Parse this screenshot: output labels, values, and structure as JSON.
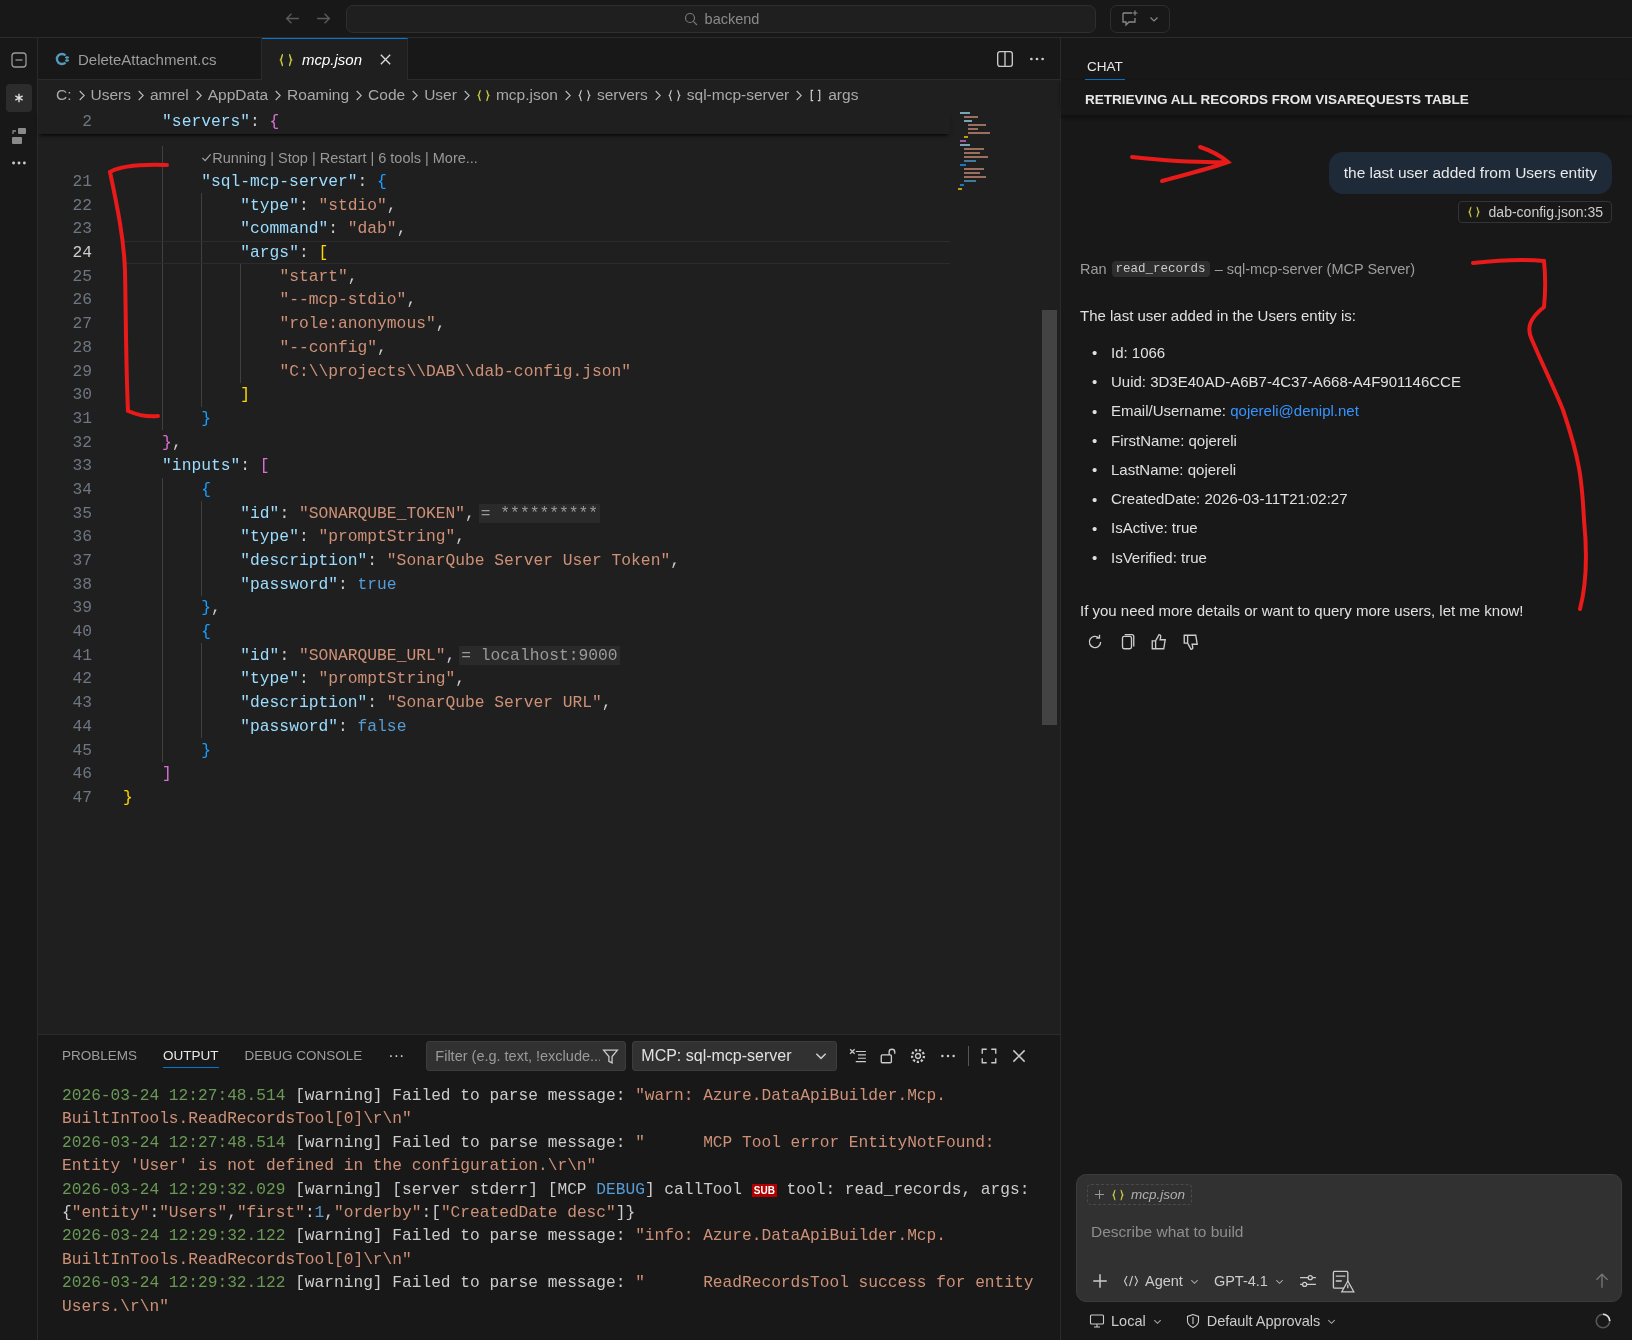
{
  "title_bar": {
    "search": "backend"
  },
  "editor_tabs": [
    {
      "label": "DeleteAttachment.cs",
      "kind": "csharp",
      "selected": false,
      "preview": false
    },
    {
      "label": "mcp.json",
      "kind": "json",
      "selected": true,
      "preview": true
    }
  ],
  "breadcrumbs": [
    {
      "label": "C:",
      "kind": "folder"
    },
    {
      "label": "Users",
      "kind": "folder"
    },
    {
      "label": "amrel",
      "kind": "folder"
    },
    {
      "label": "AppData",
      "kind": "folder"
    },
    {
      "label": "Roaming",
      "kind": "folder"
    },
    {
      "label": "Code",
      "kind": "folder"
    },
    {
      "label": "User",
      "kind": "folder"
    },
    {
      "label": "mcp.json",
      "kind": "json"
    },
    {
      "label": "servers",
      "kind": "object"
    },
    {
      "label": "sql-mcp-server",
      "kind": "object"
    },
    {
      "label": "args",
      "kind": "array"
    }
  ],
  "code_lines": [
    {
      "kind": "code",
      "number": "2",
      "current": false,
      "tokens": [
        {
          "text": "\"servers\"",
          "kind": "key"
        },
        {
          "text": ": ",
          "kind": "punct"
        },
        {
          "text": "{",
          "kind": "open2"
        }
      ]
    },
    {
      "kind": "codelens",
      "text": "Running | Stop | Restart | 6 tools | More..."
    },
    {
      "kind": "code",
      "number": "21",
      "current": false,
      "tokens": [
        {
          "text": "\"sql-mcp-server\"",
          "kind": "key"
        },
        {
          "text": ": ",
          "kind": "punct"
        },
        {
          "text": "{",
          "kind": "open3"
        }
      ]
    },
    {
      "kind": "code",
      "number": "22",
      "current": false,
      "tokens": [
        {
          "text": "\"type\"",
          "kind": "key"
        },
        {
          "text": ": ",
          "kind": "punct"
        },
        {
          "text": "\"stdio\"",
          "kind": "string"
        },
        {
          "text": ",",
          "kind": "punct"
        }
      ]
    },
    {
      "kind": "code",
      "number": "23",
      "current": false,
      "tokens": [
        {
          "text": "\"command\"",
          "kind": "key"
        },
        {
          "text": ": ",
          "kind": "punct"
        },
        {
          "text": "\"dab\"",
          "kind": "string"
        },
        {
          "text": ",",
          "kind": "punct"
        }
      ]
    },
    {
      "kind": "code",
      "number": "24",
      "current": true,
      "tokens": [
        {
          "text": "\"args\"",
          "kind": "key"
        },
        {
          "text": ": ",
          "kind": "punct"
        },
        {
          "text": "[",
          "kind": "open1"
        }
      ]
    },
    {
      "kind": "code",
      "number": "25",
      "current": false,
      "tokens": [
        {
          "text": "\"start\"",
          "kind": "string"
        },
        {
          "text": ",",
          "kind": "punct"
        }
      ]
    },
    {
      "kind": "code",
      "number": "26",
      "current": false,
      "tokens": [
        {
          "text": "\"--mcp-stdio\"",
          "kind": "string"
        },
        {
          "text": ",",
          "kind": "punct"
        }
      ]
    },
    {
      "kind": "code",
      "number": "27",
      "current": false,
      "tokens": [
        {
          "text": "\"role:anonymous\"",
          "kind": "string"
        },
        {
          "text": ",",
          "kind": "punct"
        }
      ]
    },
    {
      "kind": "code",
      "number": "28",
      "current": false,
      "tokens": [
        {
          "text": "\"--config\"",
          "kind": "string"
        },
        {
          "text": ",",
          "kind": "punct"
        }
      ]
    },
    {
      "kind": "code",
      "number": "29",
      "current": false,
      "tokens": [
        {
          "text": "\"C:\\\\projects\\\\DAB\\\\dab-config.json\"",
          "kind": "string"
        }
      ]
    },
    {
      "kind": "code",
      "number": "30",
      "current": false,
      "tokens": [
        {
          "text": "]",
          "kind": "close1"
        }
      ]
    },
    {
      "kind": "code",
      "number": "31",
      "current": false,
      "tokens": [
        {
          "text": "}",
          "kind": "close3"
        }
      ]
    },
    {
      "kind": "code",
      "number": "32",
      "current": false,
      "tokens": [
        {
          "text": "}",
          "kind": "close2"
        },
        {
          "text": ",",
          "kind": "punct"
        }
      ]
    },
    {
      "kind": "code",
      "number": "33",
      "current": false,
      "tokens": [
        {
          "text": "\"inputs\"",
          "kind": "key"
        },
        {
          "text": ": ",
          "kind": "punct"
        },
        {
          "text": "[",
          "kind": "open2"
        }
      ]
    },
    {
      "kind": "code",
      "number": "34",
      "current": false,
      "tokens": [
        {
          "text": "{",
          "kind": "open3"
        }
      ]
    },
    {
      "kind": "code",
      "number": "35",
      "current": false,
      "tokens": [
        {
          "text": "\"id\"",
          "kind": "key"
        },
        {
          "text": ": ",
          "kind": "punct"
        },
        {
          "text": "\"SONARQUBE_TOKEN\"",
          "kind": "string"
        },
        {
          "text": ",",
          "kind": "punct"
        },
        {
          "text": "= **********",
          "kind": "hint"
        }
      ]
    },
    {
      "kind": "code",
      "number": "36",
      "current": false,
      "tokens": [
        {
          "text": "\"type\"",
          "kind": "key"
        },
        {
          "text": ": ",
          "kind": "punct"
        },
        {
          "text": "\"promptString\"",
          "kind": "string"
        },
        {
          "text": ",",
          "kind": "punct"
        }
      ]
    },
    {
      "kind": "code",
      "number": "37",
      "current": false,
      "tokens": [
        {
          "text": "\"description\"",
          "kind": "key"
        },
        {
          "text": ": ",
          "kind": "punct"
        },
        {
          "text": "\"SonarQube Server User Token\"",
          "kind": "string"
        },
        {
          "text": ",",
          "kind": "punct"
        }
      ]
    },
    {
      "kind": "code",
      "number": "38",
      "current": false,
      "tokens": [
        {
          "text": "\"password\"",
          "kind": "key"
        },
        {
          "text": ": ",
          "kind": "punct"
        },
        {
          "text": "true",
          "kind": "bool"
        }
      ]
    },
    {
      "kind": "code",
      "number": "39",
      "current": false,
      "tokens": [
        {
          "text": "}",
          "kind": "close3"
        },
        {
          "text": ",",
          "kind": "punct"
        }
      ]
    },
    {
      "kind": "code",
      "number": "40",
      "current": false,
      "tokens": [
        {
          "text": "{",
          "kind": "open3"
        }
      ]
    },
    {
      "kind": "code",
      "number": "41",
      "current": false,
      "tokens": [
        {
          "text": "\"id\"",
          "kind": "key"
        },
        {
          "text": ": ",
          "kind": "punct"
        },
        {
          "text": "\"SONARQUBE_URL\"",
          "kind": "string"
        },
        {
          "text": ",",
          "kind": "punct"
        },
        {
          "text": "= localhost:9000",
          "kind": "hint"
        }
      ]
    },
    {
      "kind": "code",
      "number": "42",
      "current": false,
      "tokens": [
        {
          "text": "\"type\"",
          "kind": "key"
        },
        {
          "text": ": ",
          "kind": "punct"
        },
        {
          "text": "\"promptString\"",
          "kind": "string"
        },
        {
          "text": ",",
          "kind": "punct"
        }
      ]
    },
    {
      "kind": "code",
      "number": "43",
      "current": false,
      "tokens": [
        {
          "text": "\"description\"",
          "kind": "key"
        },
        {
          "text": ": ",
          "kind": "punct"
        },
        {
          "text": "\"SonarQube Server URL\"",
          "kind": "string"
        },
        {
          "text": ",",
          "kind": "punct"
        }
      ]
    },
    {
      "kind": "code",
      "number": "44",
      "current": false,
      "tokens": [
        {
          "text": "\"password\"",
          "kind": "key"
        },
        {
          "text": ": ",
          "kind": "punct"
        },
        {
          "text": "false",
          "kind": "bool"
        }
      ]
    },
    {
      "kind": "code",
      "number": "45",
      "current": false,
      "tokens": [
        {
          "text": "}",
          "kind": "close3"
        }
      ]
    },
    {
      "kind": "code",
      "number": "46",
      "current": false,
      "tokens": [
        {
          "text": "]",
          "kind": "close2"
        }
      ]
    },
    {
      "kind": "code",
      "number": "47",
      "current": false,
      "tokens": [
        {
          "text": "}",
          "kind": "close1"
        }
      ]
    }
  ],
  "panel": {
    "tabs": [
      {
        "label": "PROBLEMS",
        "selected": false
      },
      {
        "label": "OUTPUT",
        "selected": true
      },
      {
        "label": "DEBUG CONSOLE",
        "selected": false
      }
    ],
    "more": "···",
    "filter_placeholder": "Filter (e.g. text, !exclude...",
    "channel": "MCP: sql-mcp-server",
    "log_lines": [
      {
        "tokens": [
          {
            "text": "2026-03-24 12:27:48.514",
            "kind": "time"
          },
          {
            "text": " [warning] Failed to parse message: ",
            "kind": "plain"
          },
          {
            "text": "\"warn: Azure.DataApiBuilder.Mcp.",
            "kind": "string"
          }
        ]
      },
      {
        "tokens": [
          {
            "text": "BuiltInTools.ReadRecordsTool[0]\\r\\n\"",
            "kind": "string"
          }
        ]
      },
      {
        "tokens": [
          {
            "text": "2026-03-24 12:27:48.514",
            "kind": "time"
          },
          {
            "text": " [warning] Failed to parse message: ",
            "kind": "plain"
          },
          {
            "text": "\"      MCP Tool error EntityNotFound:",
            "kind": "string"
          }
        ]
      },
      {
        "tokens": [
          {
            "text": "Entity 'User' is not defined in the configuration.\\r\\n\"",
            "kind": "string"
          }
        ]
      },
      {
        "tokens": [
          {
            "text": "2026-03-24 12:29:32.029",
            "kind": "time"
          },
          {
            "text": " [warning] [server stderr] [MCP ",
            "kind": "plain"
          },
          {
            "text": "DEBUG",
            "kind": "debug"
          },
          {
            "text": "] callTool ",
            "kind": "plain"
          },
          {
            "text": "SUB",
            "kind": "badge"
          },
          {
            "text": " tool: read_records, args:",
            "kind": "plain"
          }
        ]
      },
      {
        "tokens": [
          {
            "text": "{",
            "kind": "plain"
          },
          {
            "text": "\"entity\"",
            "kind": "string"
          },
          {
            "text": ":",
            "kind": "plain"
          },
          {
            "text": "\"Users\"",
            "kind": "string"
          },
          {
            "text": ",",
            "kind": "plain"
          },
          {
            "text": "\"first\"",
            "kind": "string"
          },
          {
            "text": ":",
            "kind": "plain"
          },
          {
            "text": "1",
            "kind": "number"
          },
          {
            "text": ",",
            "kind": "plain"
          },
          {
            "text": "\"orderby\"",
            "kind": "string"
          },
          {
            "text": ":[",
            "kind": "plain"
          },
          {
            "text": "\"CreatedDate desc\"",
            "kind": "string"
          },
          {
            "text": "]}",
            "kind": "plain"
          }
        ]
      },
      {
        "tokens": [
          {
            "text": "2026-03-24 12:29:32.122",
            "kind": "time"
          },
          {
            "text": " [warning] Failed to parse message: ",
            "kind": "plain"
          },
          {
            "text": "\"info: Azure.DataApiBuilder.Mcp.",
            "kind": "string"
          }
        ]
      },
      {
        "tokens": [
          {
            "text": "BuiltInTools.ReadRecordsTool[0]\\r\\n\"",
            "kind": "string"
          }
        ]
      },
      {
        "tokens": [
          {
            "text": "2026-03-24 12:29:32.122",
            "kind": "time"
          },
          {
            "text": " [warning] Failed to parse message: ",
            "kind": "plain"
          },
          {
            "text": "\"      ReadRecordsTool success for entity",
            "kind": "string"
          }
        ]
      },
      {
        "tokens": [
          {
            "text": "Users.\\r\\n\"",
            "kind": "string"
          }
        ]
      }
    ]
  },
  "chat": {
    "tab": "CHAT",
    "title": "RETRIEVING ALL RECORDS FROM VISAREQUESTS TABLE",
    "request": "the last user added from Users entity",
    "attachment": "dab-config.json:35",
    "tool_run": {
      "prefix": "Ran",
      "tool": "read_records",
      "suffix": "– sql-mcp-server (MCP Server)"
    },
    "intro": "The last user added in the Users entity is:",
    "bullets": [
      {
        "marker": "•",
        "text": "Id: 1066"
      },
      {
        "marker": "•",
        "text": "Uuid: 3D3E40AD-A6B7-4C37-A668-A4F901146CCE"
      },
      {
        "marker": "•",
        "text": "Email/Username: ",
        "link": "qojereli@denipl.net"
      },
      {
        "marker": "•",
        "text": "FirstName: qojereli"
      },
      {
        "marker": "•",
        "text": "LastName: qojereli"
      },
      {
        "marker": "•",
        "text": "CreatedDate: 2026-03-11T21:02:27"
      },
      {
        "marker": "•",
        "text": "IsActive: true"
      },
      {
        "marker": "•",
        "text": "IsVerified: true"
      }
    ],
    "closing": "If you need more details or want to query more users, let me know!",
    "input": {
      "chip": "mcp.json",
      "placeholder": "Describe what to build",
      "mode": "Agent",
      "model": "GPT-4.1"
    },
    "status": {
      "location": "Local",
      "approvals": "Default Approvals"
    }
  }
}
